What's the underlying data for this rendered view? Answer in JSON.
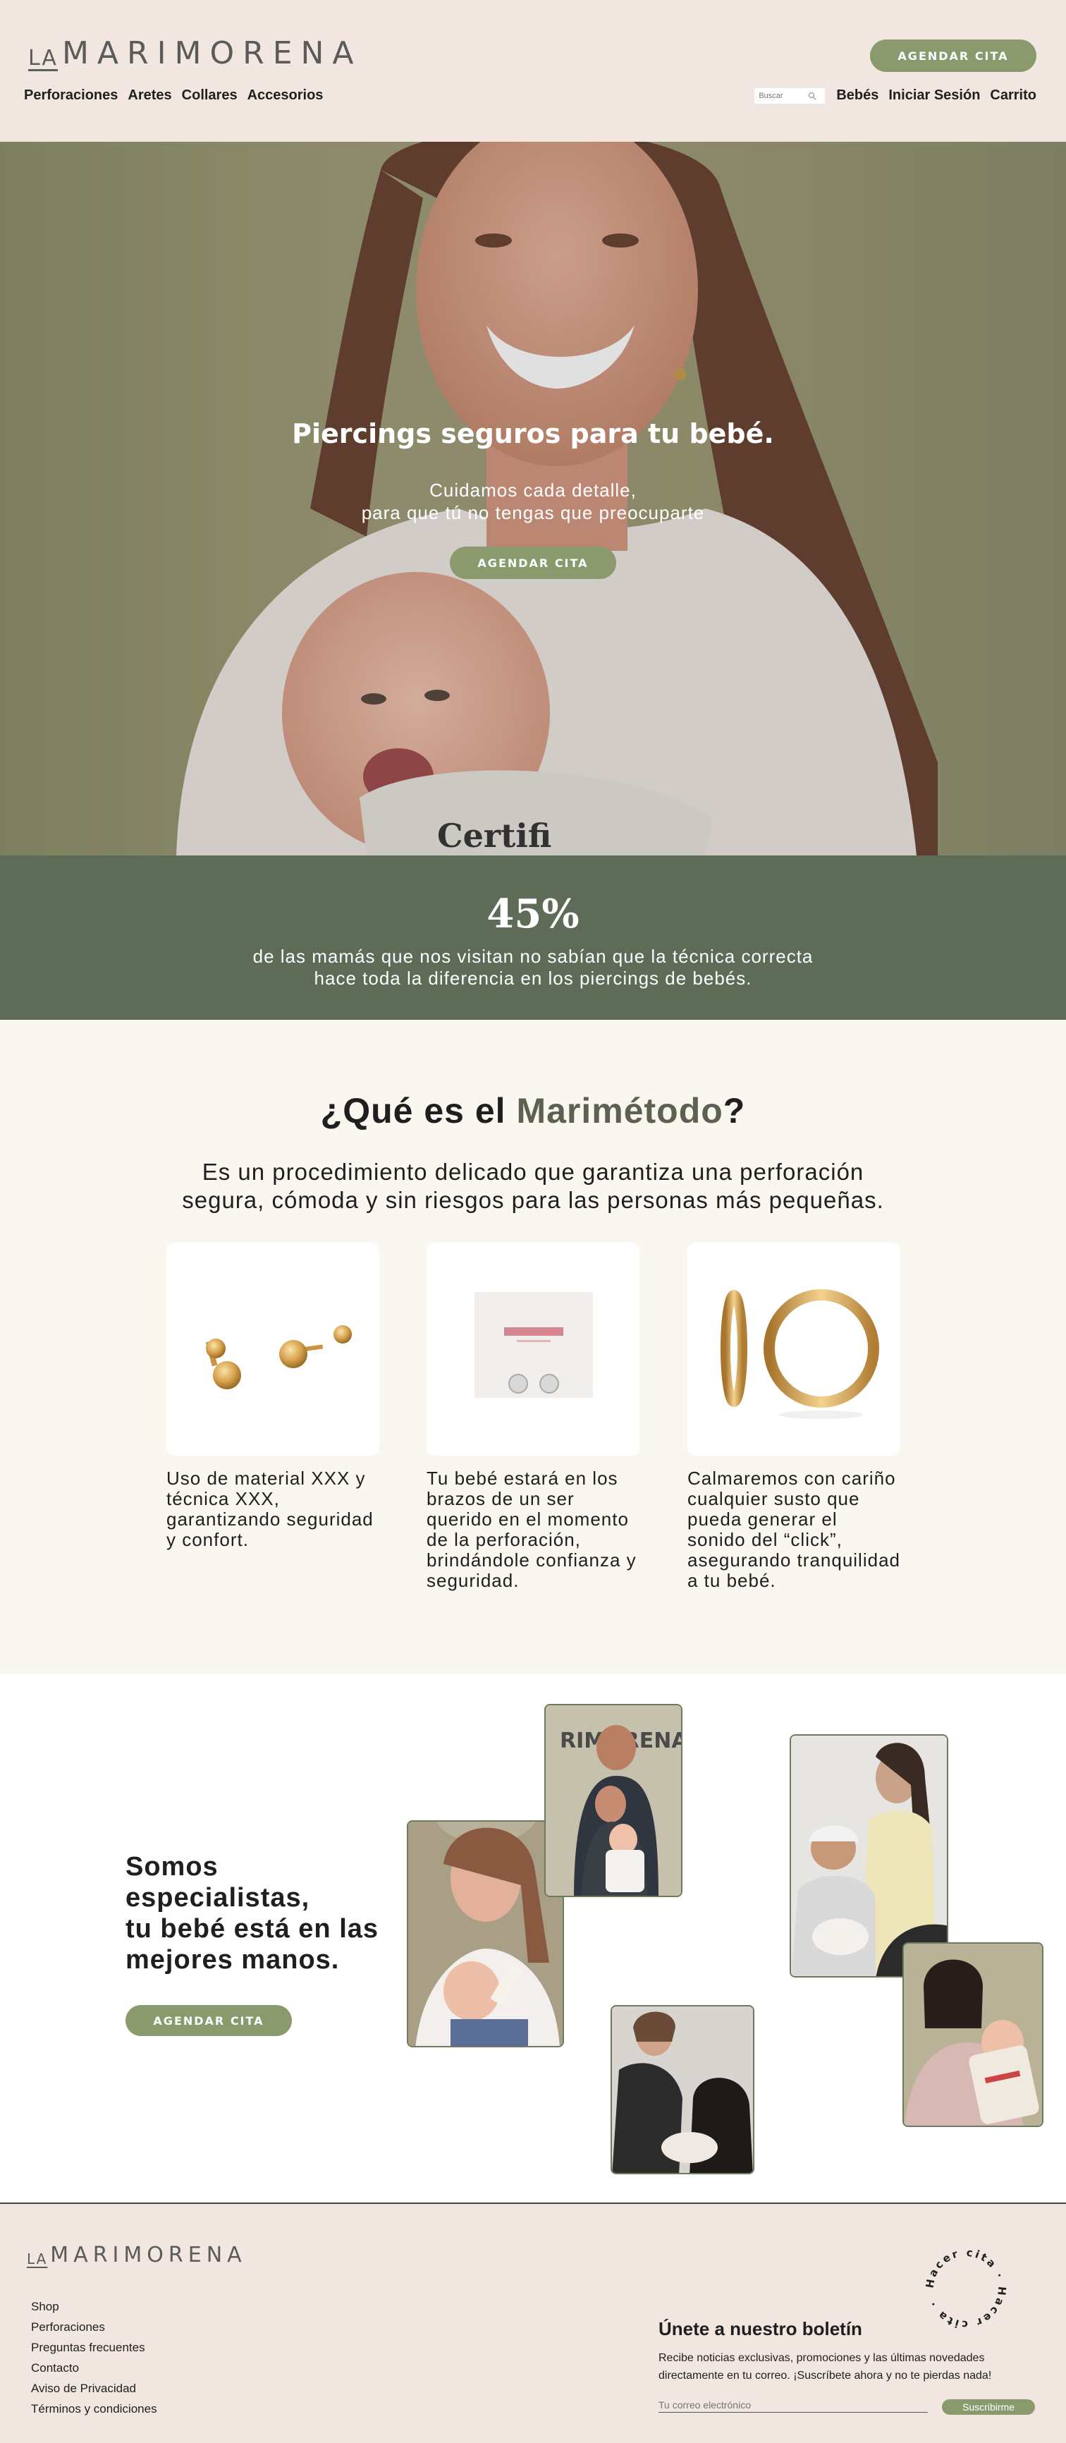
{
  "header": {
    "logo_la": "LA",
    "logo_main": "MARIMORENA",
    "cta_label": "AGENDAR CITA",
    "nav_left": [
      "Perforaciones",
      "Aretes",
      "Collares",
      "Accesorios"
    ],
    "search_placeholder": "Buscar",
    "nav_right": [
      "Bebés",
      "Iniciar Sesión",
      "Carrito"
    ]
  },
  "hero": {
    "title": "Piercings seguros para tu bebé.",
    "subtitle_line1": "Cuidamos cada detalle,",
    "subtitle_line2": "para que tú no tengas que preocuparte",
    "cta_label": "AGENDAR CITA",
    "box_text": "Certifi"
  },
  "stat": {
    "value": "45%",
    "line1": "de las mamás que nos visitan no sabían que la técnica correcta",
    "line2": "hace toda la diferencia en los piercings de bebés."
  },
  "method": {
    "title_pre": "¿Qué es el ",
    "title_accent": "Marimétodo",
    "title_post": "?",
    "subtitle_line1": "Es un procedimiento delicado que garantiza una perforación",
    "subtitle_line2": "segura, cómoda y sin riesgos para las personas más pequeñas.",
    "cards": [
      {
        "text": "Uso de material XXX y técnica XXX, garantizando seguridad y confort."
      },
      {
        "text": "Tu bebé estará en los brazos de un ser querido en el momento de la perforación, brindándole confianza y seguridad."
      },
      {
        "text": "Calmaremos con cariño cualquier susto que pueda generar el sonido del “click”, asegurando tranquilidad a tu bebé."
      }
    ]
  },
  "specialists": {
    "title_line1": "Somos",
    "title_line2": "especialistas,",
    "title_line3": "tu bebé está en las",
    "title_line4": "mejores manos.",
    "cta_label": "AGENDAR CITA",
    "wall_text": "RIMORENA"
  },
  "footer": {
    "logo_la": "LA",
    "logo_main": "MARIMORENA",
    "links": [
      "Shop",
      "Perforaciones",
      "Preguntas frecuentes",
      "Contacto",
      "Aviso de Privacidad",
      "Términos y condiciones"
    ],
    "newsletter_title": "Únete a nuestro boletín",
    "newsletter_text": "Recibe noticias exclusivas, promociones y las últimas novedades directamente en tu correo. ¡Suscríbete ahora y no te pierdas nada!",
    "email_placeholder": "Tu correo electrónico",
    "subscribe_label": "Suscribirme",
    "badge_text": "Hacer cita · Hacer cita ·"
  },
  "colors": {
    "accent": "#8a9a6c",
    "header_bg": "#f1e6e0",
    "stat_bg": "#5e6b57",
    "method_bg": "#f9f7ef"
  }
}
